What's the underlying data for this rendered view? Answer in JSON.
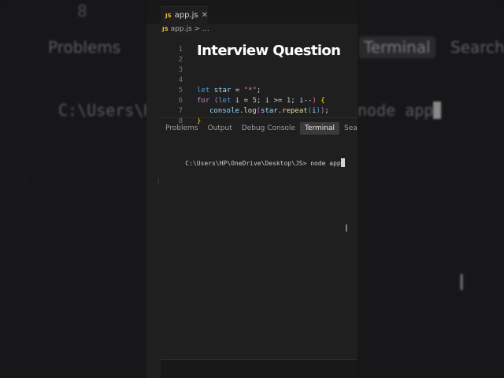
{
  "background": {
    "left_digit": "8",
    "left_problems": "Problems",
    "left_path": "C:\\Users\\H",
    "right_terminal": "Terminal",
    "right_search": "Search",
    "right_cmd": "node app"
  },
  "overlay": {
    "title": "Interview Question"
  },
  "editor": {
    "tab": {
      "badge": "JS",
      "filename": "app.js",
      "close": "✕"
    },
    "breadcrumb": {
      "badge": "JS",
      "file": "app.js",
      "separator": ">",
      "more": "..."
    },
    "line_numbers": [
      "1",
      "2",
      "3",
      "4",
      "5",
      "6",
      "7",
      "8"
    ]
  },
  "panel": {
    "tabs": [
      "Problems",
      "Output",
      "Debug Console",
      "Terminal",
      "Search"
    ],
    "active_tab": "Terminal",
    "terminal_prompt": "C:\\Users\\HP\\OneDrive\\Desktop\\JS> node app"
  },
  "colors": {
    "background": "#1f1f1f",
    "keyword": "#c586c0",
    "string": "#ce9178",
    "function": "#dcdcaa",
    "js_badge": "#e7c03a"
  }
}
